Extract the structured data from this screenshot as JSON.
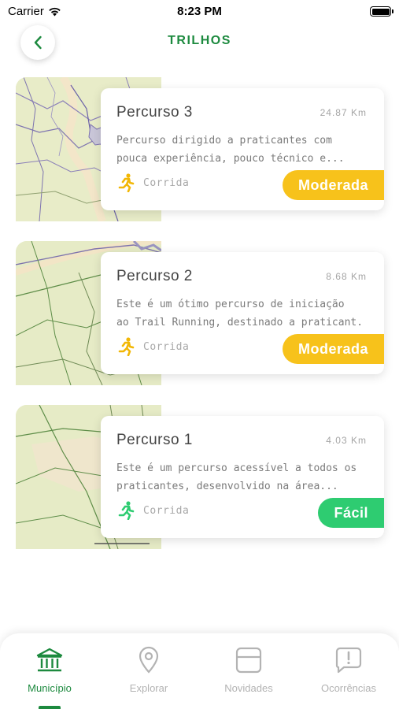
{
  "status_bar": {
    "carrier": "Carrier",
    "time": "8:23 PM"
  },
  "header": {
    "title": "TRILHOS"
  },
  "colors": {
    "brand_green": "#1d8a3f",
    "moderate": "#f7c21b",
    "easy": "#2ecc71",
    "runner_moderate": "#f2b705",
    "runner_easy": "#2ecc71"
  },
  "trails": [
    {
      "name": "Percurso 3",
      "distance": "24.87 Km",
      "description_line1": "Percurso dirigido a praticantes com",
      "description_line2": "pouca experiência, pouco técnico e...",
      "activity": "Corrida",
      "activity_icon": "runner-icon",
      "difficulty": "Moderada"
    },
    {
      "name": "Percurso 2",
      "distance": "8.68 Km",
      "description_line1": "Este é um ótimo percurso de iniciação",
      "description_line2": "ao Trail Running, destinado a praticant...",
      "activity": "Corrida",
      "activity_icon": "runner-icon",
      "difficulty": "Moderada"
    },
    {
      "name": "Percurso 1",
      "distance": "4.03 Km",
      "description_line1": "Este é um percurso acessível a todos os",
      "description_line2": "praticantes, desenvolvido na área...",
      "activity": "Corrida",
      "activity_icon": "runner-icon",
      "difficulty": "Fácil"
    }
  ],
  "bottom_nav": {
    "items": [
      {
        "label": "Município",
        "icon": "building-icon",
        "active": true
      },
      {
        "label": "Explorar",
        "icon": "location-pin-icon",
        "active": false
      },
      {
        "label": "Novidades",
        "icon": "news-card-icon",
        "active": false
      },
      {
        "label": "Ocorrências",
        "icon": "alert-bubble-icon",
        "active": false
      }
    ]
  }
}
